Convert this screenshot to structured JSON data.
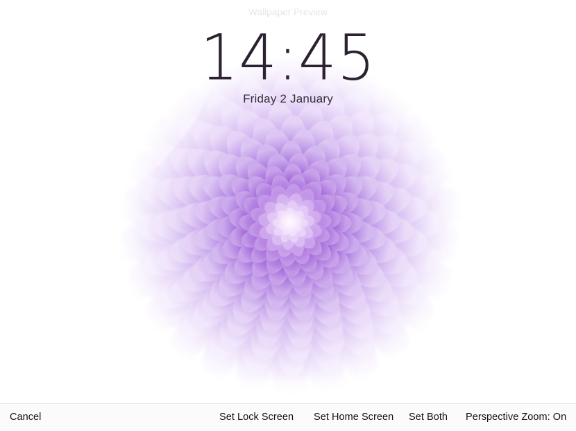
{
  "window": {
    "title": "Wallpaper Preview"
  },
  "lock_screen": {
    "time": "14:45",
    "date": "Friday 2 January"
  },
  "toolbar": {
    "cancel_label": "Cancel",
    "set_lock_screen_label": "Set Lock Screen",
    "set_home_screen_label": "Set Home Screen",
    "set_both_label": "Set Both",
    "perspective_zoom_label": "Perspective Zoom: On"
  },
  "wallpaper": {
    "subject": "purple dahlia flower",
    "background_color": "#ffffff",
    "petal_color_core": "#8a3fd0",
    "petal_color_mid": "#9a5ada",
    "petal_color_outer": "#c9a6ec",
    "petal_color_edge": "#f0e6fb",
    "center_glow_color": "#fdf6ff"
  }
}
